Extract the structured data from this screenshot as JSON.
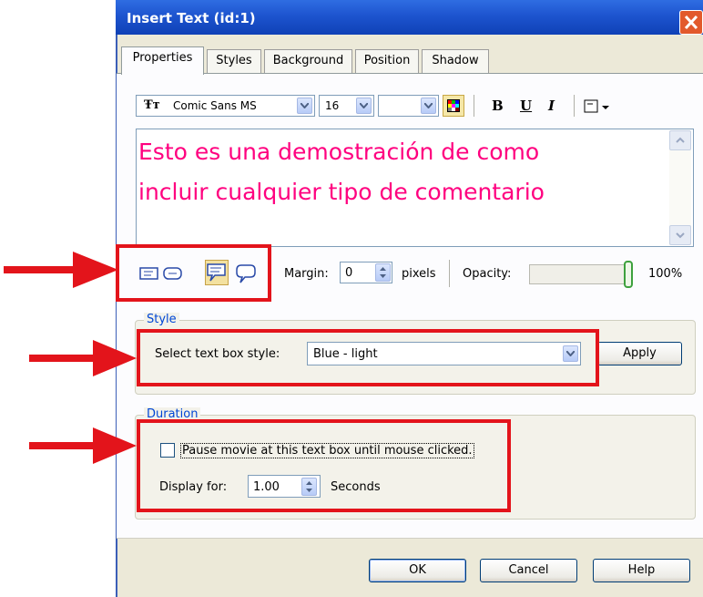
{
  "window": {
    "title": "Insert Text (id:1)"
  },
  "tabs": [
    {
      "label": "Properties",
      "active": true
    },
    {
      "label": "Styles"
    },
    {
      "label": "Background"
    },
    {
      "label": "Position"
    },
    {
      "label": "Shadow"
    }
  ],
  "toolbar": {
    "font_name": "Comic Sans MS",
    "font_size": "16",
    "bold": "B",
    "underline": "U",
    "italic": "I"
  },
  "text_content": "Esto es una demostración de como\nincluir cualquier tipo de comentario",
  "text_color": "#ff007f",
  "margin": {
    "label": "Margin:",
    "value": "0",
    "unit": "pixels"
  },
  "opacity": {
    "label": "Opacity:",
    "value_text": "100%",
    "value": 1.0
  },
  "style_group": {
    "legend": "Style",
    "select_label": "Select text box style:",
    "selected": "Blue - light",
    "apply": "Apply"
  },
  "duration_group": {
    "legend": "Duration",
    "pause_label": "Pause movie at this text box until mouse clicked.",
    "pause_checked": false,
    "display_label": "Display for:",
    "display_value": "1.00",
    "display_unit": "Seconds"
  },
  "buttons": {
    "ok": "OK",
    "cancel": "Cancel",
    "help": "Help"
  },
  "colors": {
    "annotation": "#e3141b",
    "titlebar": "#1d54cf",
    "legend": "#0046d5"
  }
}
